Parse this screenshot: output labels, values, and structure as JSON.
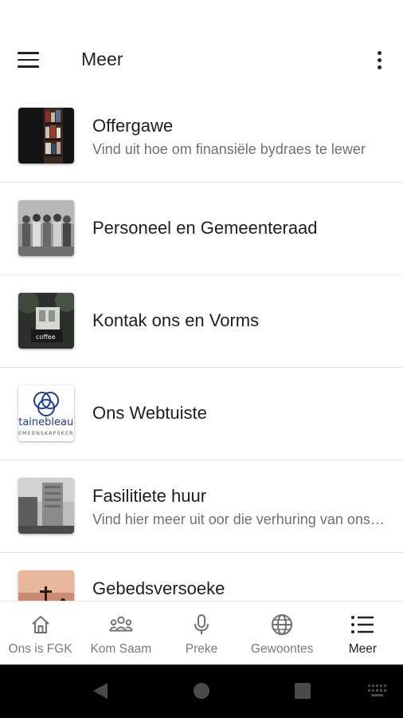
{
  "app_bar": {
    "title": "Meer"
  },
  "items": [
    {
      "title": "Offergawe",
      "subtitle": "Vind uit hoe om finansiële bydraes te lewer",
      "thumb": "bookshelf-photo"
    },
    {
      "title": "Personeel en Gemeenteraad",
      "subtitle": "",
      "thumb": "group-photo"
    },
    {
      "title": "Kontak ons en Vorms",
      "subtitle": "",
      "thumb": "coffee-shop-photo"
    },
    {
      "title": "Ons Webtuiste",
      "subtitle": "",
      "thumb": "church-logo",
      "logo_text_top": "ntainebleau",
      "logo_text_bottom": "GEMEENSKAPSKERK"
    },
    {
      "title": "Fasilitiete huur",
      "subtitle": "Vind hier meer uit oor die verhuring van ons fasiliteite",
      "thumb": "building-photo"
    },
    {
      "title": "Gebedsversoeke",
      "subtitle": "",
      "thumb": "sunset-cross-photo"
    }
  ],
  "bottom_nav": [
    {
      "label": "Ons is FGK",
      "icon": "home-icon",
      "active": false
    },
    {
      "label": "Kom Saam",
      "icon": "people-icon",
      "active": false
    },
    {
      "label": "Preke",
      "icon": "microphone-icon",
      "active": false
    },
    {
      "label": "Gewoontes",
      "icon": "globe-icon",
      "active": false
    },
    {
      "label": "Meer",
      "icon": "list-icon",
      "active": true
    }
  ],
  "colors": {
    "accent": "#222222",
    "inactive": "#7a7a7a",
    "divider": "#e6e6e6",
    "logo_blue": "#1f3d8c"
  }
}
